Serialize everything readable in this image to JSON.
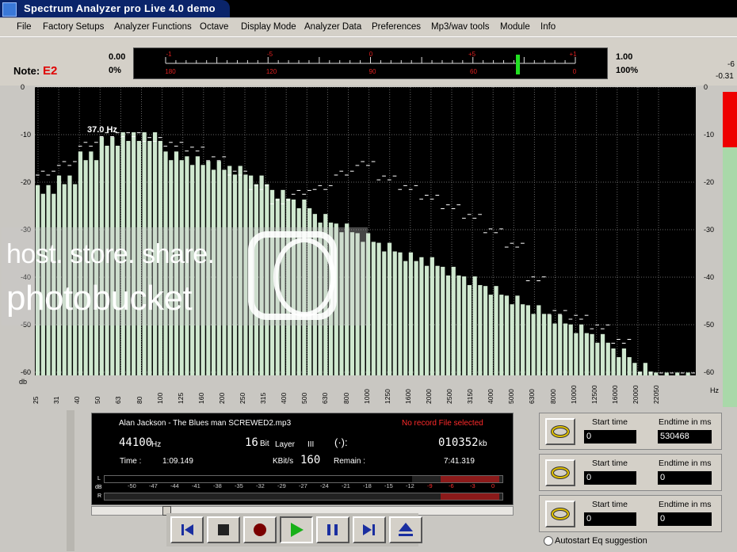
{
  "app": {
    "title": "Spectrum Analyzer pro Live 4.0 demo"
  },
  "menu": [
    "File",
    "Factory Setups",
    "Analyzer Functions",
    "Octave",
    "Display Mode",
    "Analyzer Data",
    "Preferences",
    "Mp3/wav tools",
    "Module",
    "Info"
  ],
  "note": {
    "label": "Note:",
    "value": "E2"
  },
  "tuner": {
    "left_top": "0.00",
    "left_bottom": "0%",
    "right_top": "1.00",
    "right_bottom": "100%",
    "offsets": [
      "-1",
      "-5",
      "0",
      "+5",
      "+1"
    ],
    "degrees": [
      "180",
      "120",
      "90",
      "60",
      "0"
    ],
    "needle_value": 0.86,
    "edge_top": "-6",
    "edge_bottom": "-0.31"
  },
  "chart_data": {
    "type": "bar",
    "title": "",
    "peak_label": "37.0 Hz",
    "ylabel": "db",
    "xlabel": "Hz",
    "y_ticks": [
      "0",
      "-10",
      "-20",
      "-30",
      "-40",
      "-50",
      "-60"
    ],
    "ylim": [
      -60,
      0
    ],
    "x_ticks": [
      "25",
      "31",
      "40",
      "50",
      "63",
      "80",
      "100",
      "125",
      "160",
      "200",
      "250",
      "315",
      "400",
      "500",
      "630",
      "800",
      "1000",
      "1250",
      "1600",
      "2000",
      "2500",
      "3150",
      "4000",
      "5000",
      "6300",
      "8000",
      "10000",
      "12500",
      "16000",
      "20000",
      "22050"
    ],
    "series": [
      {
        "values": [
          -21,
          -19,
          -14,
          -11,
          -10,
          -10,
          -14,
          -15,
          -16,
          -17,
          -19,
          -22,
          -24,
          -27,
          -29,
          -31,
          -33,
          -35,
          -36,
          -38,
          -40,
          -42,
          -44,
          -46,
          -48,
          -50,
          -52,
          -55,
          -58,
          -60,
          -60
        ]
      },
      {
        "values": [
          -18,
          -16,
          -12,
          -10,
          -10,
          -11,
          -12,
          -13,
          -15,
          -18,
          -21,
          -24,
          -22,
          -21,
          -18,
          -16,
          -19,
          -21,
          -23,
          -25,
          -27,
          -30,
          -33,
          -40,
          -47,
          -48,
          -50,
          -53,
          -60,
          -60,
          -60
        ]
      }
    ]
  },
  "track": {
    "filename": "Alan Jackson - The Blues man SCREWED2.mp3",
    "record_status": "No record File selected",
    "rate": "44100",
    "rate_unit": "Hz",
    "bits": "16",
    "bits_unit": "Bit",
    "layer_label": "Layer",
    "layer_value": "III",
    "size": "010352",
    "size_unit": "kb",
    "time_label": "Time :",
    "time_value": "1:09.149",
    "kbits_label": "KBit/s",
    "kbits_value": "160",
    "remain_label": "Remain :",
    "remain_value": "7:41.319",
    "progress": 0.17
  },
  "vu": {
    "scale": [
      "-50",
      "-47",
      "-44",
      "-41",
      "-38",
      "-35",
      "-32",
      "-29",
      "-27",
      "-24",
      "-21",
      "-18",
      "-15",
      "-12",
      "-9",
      "-6",
      "-3",
      "0"
    ],
    "l_label": "L",
    "db_label": "dB",
    "r_label": "R"
  },
  "loops": [
    {
      "start_label": "Start time",
      "end_label": "Endtime in ms",
      "start": "0",
      "end": "530468"
    },
    {
      "start_label": "Start time",
      "end_label": "Endtime in ms",
      "start": "0",
      "end": "0"
    },
    {
      "start_label": "Start time",
      "end_label": "Endtime in ms",
      "start": "0",
      "end": "0"
    }
  ],
  "autostart_label": "Autostart Eq suggestion",
  "watermark": {
    "line1": "host. store. share.",
    "line2": "photobucket"
  }
}
